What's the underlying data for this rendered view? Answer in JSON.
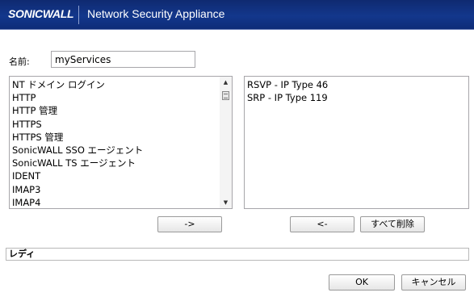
{
  "header": {
    "logo": "SONICWALL",
    "title": "Network Security Appliance"
  },
  "name_field": {
    "label": "名前:",
    "value": "myServices"
  },
  "available_services": [
    "NT ドメイン ログイン",
    "HTTP",
    "HTTP 管理",
    "HTTPS",
    "HTTPS 管理",
    "SonicWALL SSO エージェント",
    "SonicWALL TS エージェント",
    "IDENT",
    "IMAP3",
    "IMAP4"
  ],
  "selected_services": [
    "RSVP - IP Type 46",
    "SRP - IP Type 119"
  ],
  "buttons": {
    "add": "->",
    "remove": "<-",
    "remove_all": "すべて削除",
    "ok": "OK",
    "cancel": "キャンセル"
  },
  "status": "レディ",
  "icons": {
    "scroll_up": "triangle-up",
    "scroll_down": "triangle-down"
  }
}
